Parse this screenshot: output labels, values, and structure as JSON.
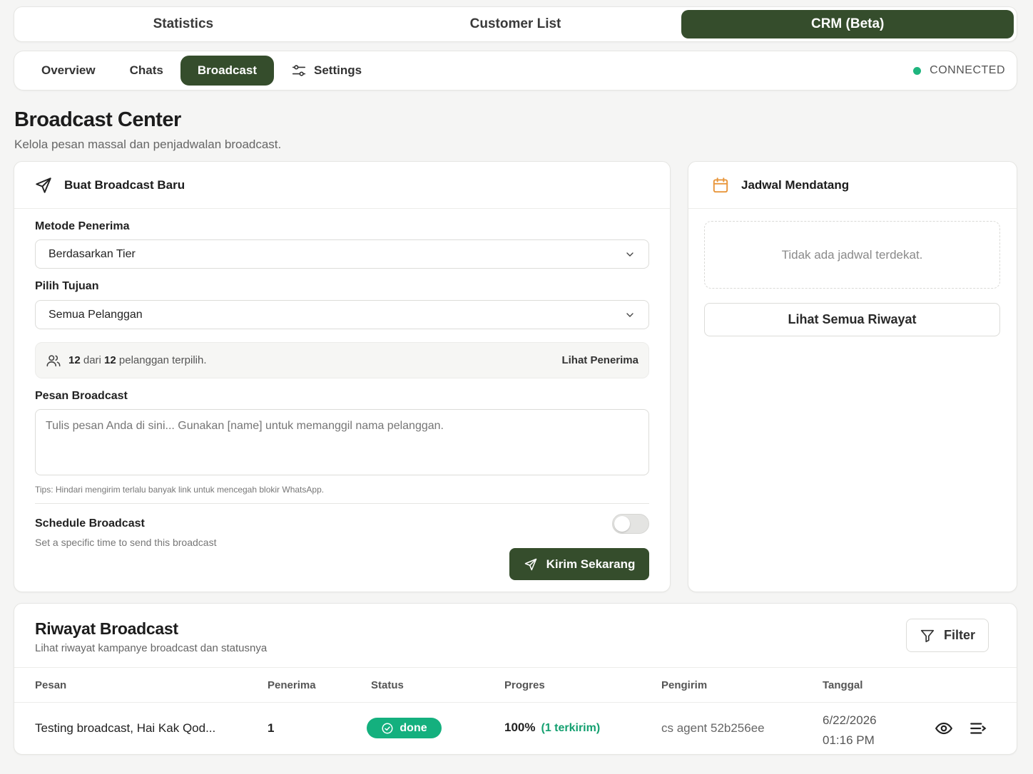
{
  "colors": {
    "accent": "#354d2c",
    "success": "#14b07e",
    "status_dot": "#1fb57e",
    "calendar_icon": "#e8963c"
  },
  "top_tabs": [
    {
      "label": "Statistics",
      "active": false
    },
    {
      "label": "Customer List",
      "active": false
    },
    {
      "label": "CRM (Beta)",
      "active": true
    }
  ],
  "sub_nav": {
    "tabs": [
      {
        "label": "Overview",
        "icon": null,
        "active": false
      },
      {
        "label": "Chats",
        "icon": null,
        "active": false
      },
      {
        "label": "Broadcast",
        "icon": null,
        "active": true
      },
      {
        "label": "Settings",
        "icon": "sliders-icon",
        "active": false
      }
    ],
    "connection_status": "CONNECTED"
  },
  "header": {
    "title": "Broadcast Center",
    "subtitle": "Kelola pesan massal dan penjadwalan broadcast."
  },
  "new_broadcast": {
    "title": "Buat Broadcast Baru",
    "icon": "send-icon",
    "method_label": "Metode Penerima",
    "method_value": "Berdasarkan Tier",
    "target_label": "Pilih Tujuan",
    "target_value": "Semua Pelanggan",
    "recipients": {
      "selected": "12",
      "connector": "dari",
      "total": "12",
      "suffix": "pelanggan terpilih.",
      "link": "Lihat Penerima"
    },
    "message_label": "Pesan Broadcast",
    "message_placeholder": "Tulis pesan Anda di sini... Gunakan [name] untuk memanggil nama pelanggan.",
    "tips": "Tips: Hindari mengirim terlalu banyak link untuk mencegah blokir WhatsApp.",
    "schedule_title": "Schedule Broadcast",
    "schedule_sub": "Set a specific time to send this broadcast",
    "schedule_enabled": false,
    "send_label": "Kirim Sekarang"
  },
  "upcoming": {
    "title": "Jadwal Mendatang",
    "icon": "calendar-icon",
    "empty_text": "Tidak ada jadwal terdekat.",
    "history_button": "Lihat Semua Riwayat"
  },
  "history": {
    "title": "Riwayat Broadcast",
    "subtitle": "Lihat riwayat kampanye broadcast dan statusnya",
    "filter_label": "Filter",
    "columns": [
      "Pesan",
      "Penerima",
      "Status",
      "Progres",
      "Pengirim",
      "Tanggal"
    ],
    "rows": [
      {
        "message": "Testing broadcast, Hai Kak Qod...",
        "recipients": "1",
        "status": "done",
        "progress": "100%",
        "sent": "(1 terkirim)",
        "sender": "cs agent 52b256ee",
        "date": "6/22/2026",
        "time": "01:16 PM"
      }
    ]
  }
}
